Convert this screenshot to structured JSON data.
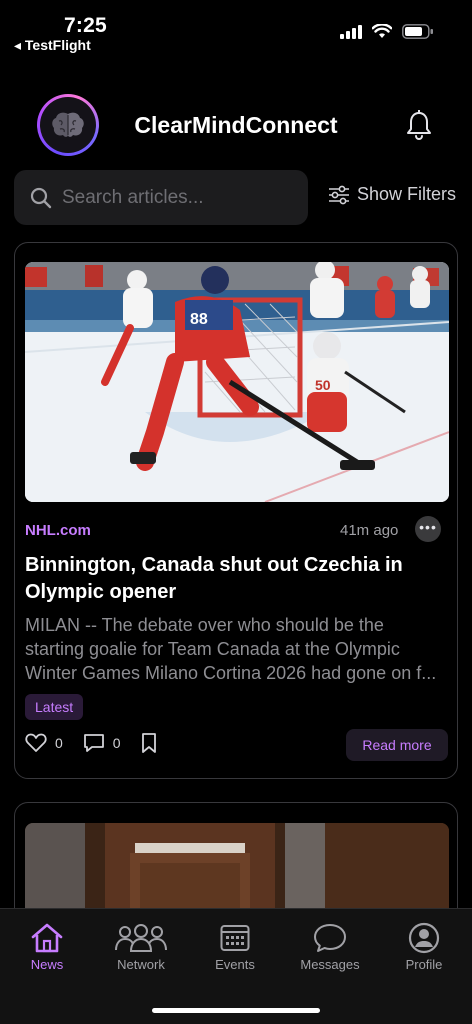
{
  "status": {
    "time": "7:25",
    "back_label": "◂ TestFlight"
  },
  "header": {
    "title": "ClearMindConnect"
  },
  "search": {
    "placeholder": "Search articles...",
    "value": "",
    "filters_label": "Show Filters"
  },
  "article": {
    "source": "NHL.com",
    "time_ago": "41m ago",
    "more_label": "•••",
    "headline": "Binnington, Canada shut out Czechia in Olympic opener",
    "excerpt": "MILAN -- The debate over who should be the starting goalie for Team Canada at the Olympic Winter Games Milano Cortina 2026 had gone on f...",
    "tag": "Latest",
    "likes": "0",
    "comments": "0",
    "read_more": "Read more",
    "player_number": "88"
  },
  "tabs": [
    {
      "label": "News",
      "icon": "home-icon",
      "active": true
    },
    {
      "label": "Network",
      "icon": "people-icon",
      "active": false
    },
    {
      "label": "Events",
      "icon": "calendar-icon",
      "active": false
    },
    {
      "label": "Messages",
      "icon": "chat-icon",
      "active": false
    },
    {
      "label": "Profile",
      "icon": "profile-icon",
      "active": false
    }
  ],
  "colors": {
    "accent": "#c77dff",
    "background": "#000000",
    "card_border": "#38383c",
    "muted_text": "#8e8e93"
  }
}
